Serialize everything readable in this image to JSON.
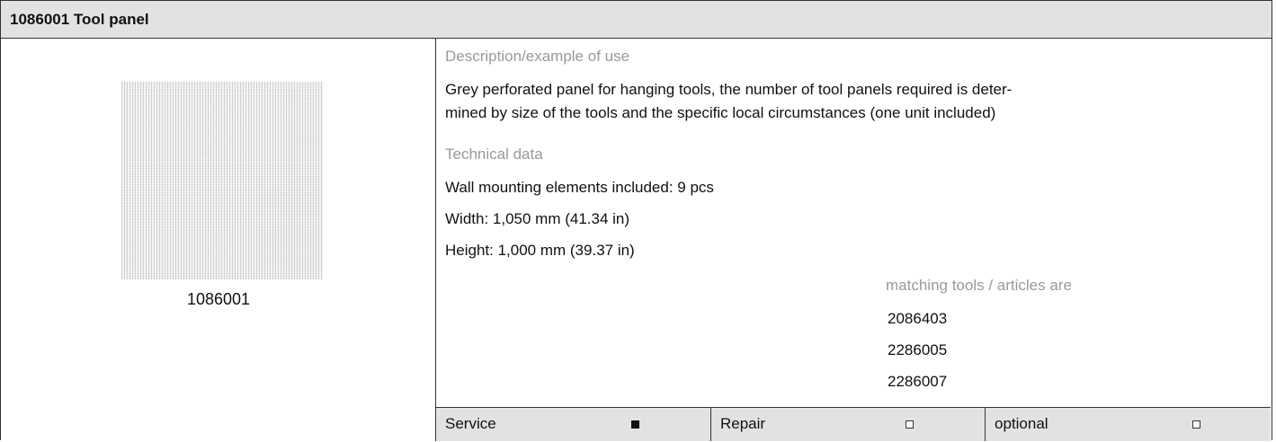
{
  "header": {
    "title": "1086001 Tool panel"
  },
  "image": {
    "caption": "1086001"
  },
  "description": {
    "heading": "Description/example of use",
    "line1": "Grey perforated panel for hanging tools, the number of tool panels required is deter-",
    "line2": "mined by size of the tools and the specific local circumstances (one unit included)"
  },
  "technical": {
    "heading": "Technical data",
    "items": [
      "Wall mounting elements included: 9 pcs",
      "Width: 1,050 mm (41.34 in)",
      "Height: 1,000 mm (39.37 in)"
    ]
  },
  "matching": {
    "heading": "matching tools / articles are",
    "items": [
      "2086403",
      "2286005",
      "2286007"
    ]
  },
  "footer": {
    "cells": [
      {
        "label": "Service",
        "checked": true
      },
      {
        "label": "Repair",
        "checked": false
      },
      {
        "label": "optional",
        "checked": false
      }
    ]
  }
}
